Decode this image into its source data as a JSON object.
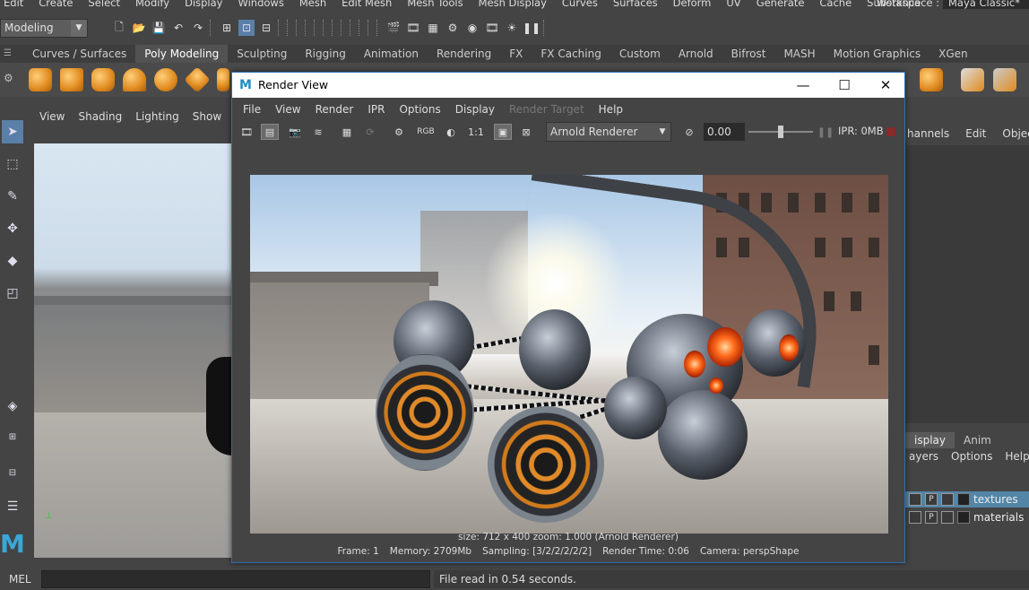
{
  "menubar": {
    "items": [
      "Edit",
      "Create",
      "Select",
      "Modify",
      "Display",
      "Windows",
      "Mesh",
      "Edit Mesh",
      "Mesh Tools",
      "Mesh Display",
      "Curves",
      "Surfaces",
      "Deform",
      "UV",
      "Generate",
      "Cache",
      "Substance"
    ],
    "workspace_label": "Workspace :",
    "workspace_value": "Maya Classic*"
  },
  "statusline": {
    "mode": "Modeling"
  },
  "shelf": {
    "tabs": [
      "Curves / Surfaces",
      "Poly Modeling",
      "Sculpting",
      "Rigging",
      "Animation",
      "Rendering",
      "FX",
      "FX Caching",
      "Custom",
      "Arnold",
      "Bifrost",
      "MASH",
      "Motion Graphics",
      "XGen"
    ],
    "active_tab": "Poly Modeling"
  },
  "viewport": {
    "menu": [
      "View",
      "Shading",
      "Lighting",
      "Show",
      "Re"
    ]
  },
  "render_view": {
    "title": "Render View",
    "menu": [
      "File",
      "View",
      "Render",
      "IPR",
      "Options",
      "Display",
      "Render Target",
      "Help"
    ],
    "disabled_menu": "Render Target",
    "toolbar": {
      "rgb_label": "RGB",
      "ratio_label": "1:1",
      "renderer": "Arnold Renderer",
      "exposure": "0.00",
      "exposure_level": 0.5,
      "ipr_memory": "IPR: 0MB"
    },
    "info_line1": "size: 712 x 400 zoom: 1.000    (Arnold Renderer)",
    "info_line2": {
      "frame": "Frame: 1",
      "memory": "Memory: 2709Mb",
      "sampling": "Sampling: [3/2/2/2/2/2]",
      "render_time": "Render Time: 0:06",
      "camera": "Camera: perspShape"
    }
  },
  "right_panel": {
    "top_menu": [
      "hannels",
      "Edit",
      "Object"
    ],
    "tabs": [
      "isplay",
      "Anim"
    ],
    "active_tab": "isplay",
    "menu": [
      "ayers",
      "Options",
      "Help"
    ],
    "layers": [
      {
        "name": "textures",
        "flag": "P",
        "selected": true
      },
      {
        "name": "materials",
        "flag": "P",
        "selected": false
      }
    ]
  },
  "command_line": {
    "language": "MEL",
    "result": "File read in  0.54 seconds."
  },
  "colors": {
    "accent": "#5285a6",
    "window_border": "#2f6db3",
    "shelf_icon": "#e08a1e"
  }
}
